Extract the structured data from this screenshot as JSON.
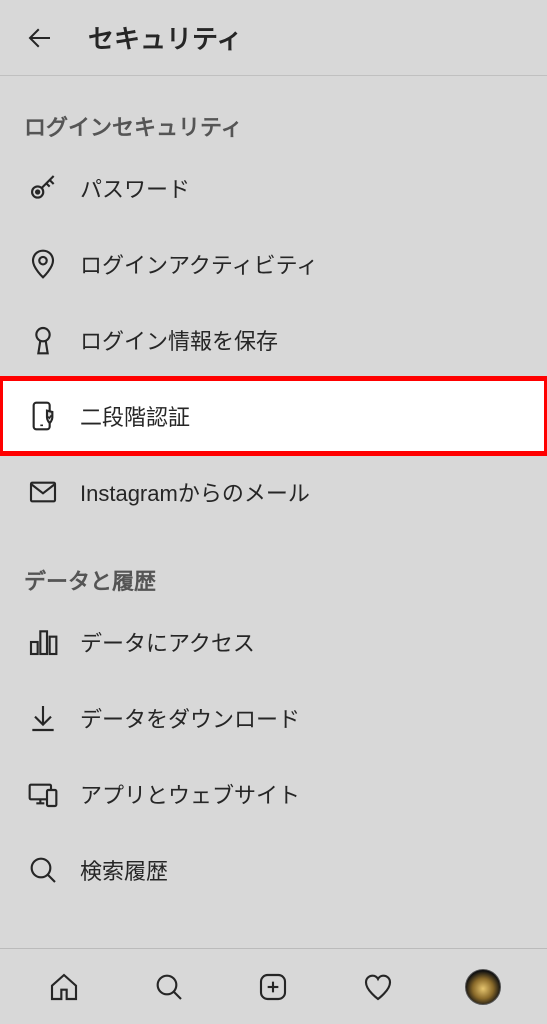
{
  "header": {
    "title": "セキュリティ"
  },
  "sections": [
    {
      "title": "ログインセキュリティ",
      "items": [
        {
          "icon": "key-icon",
          "label": "パスワード",
          "highlighted": false
        },
        {
          "icon": "pin-icon",
          "label": "ログインアクティビティ",
          "highlighted": false
        },
        {
          "icon": "keyhole-icon",
          "label": "ログイン情報を保存",
          "highlighted": false
        },
        {
          "icon": "phone-shield-icon",
          "label": "二段階認証",
          "highlighted": true
        },
        {
          "icon": "mail-icon",
          "label": "Instagramからのメール",
          "highlighted": false
        }
      ]
    },
    {
      "title": "データと履歴",
      "items": [
        {
          "icon": "bar-chart-icon",
          "label": "データにアクセス",
          "highlighted": false
        },
        {
          "icon": "download-icon",
          "label": "データをダウンロード",
          "highlighted": false
        },
        {
          "icon": "devices-icon",
          "label": "アプリとウェブサイト",
          "highlighted": false
        },
        {
          "icon": "search-icon",
          "label": "検索履歴",
          "highlighted": false
        }
      ]
    }
  ],
  "nav": {
    "home": "home-icon",
    "search": "search-icon",
    "add": "add-icon",
    "activity": "heart-icon",
    "profile": "avatar"
  }
}
